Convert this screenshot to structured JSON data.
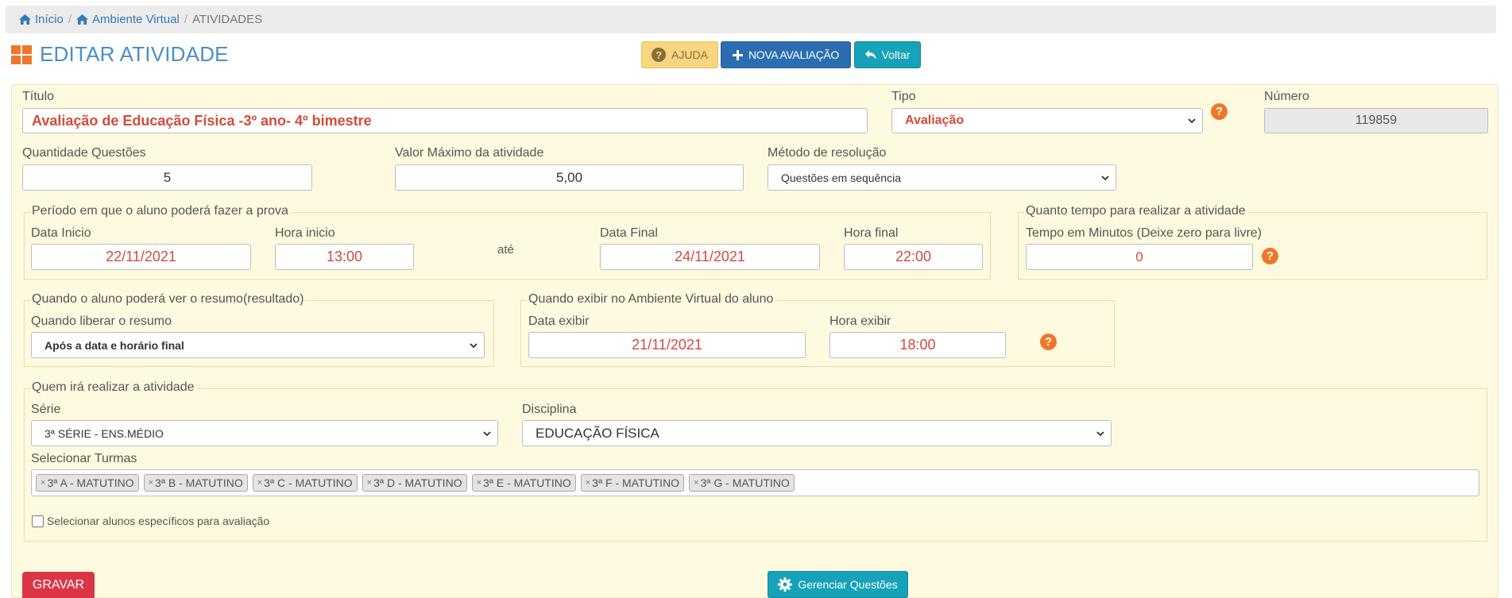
{
  "breadcrumb": {
    "items": [
      {
        "label": "Início"
      },
      {
        "label": "Ambiente Virtual"
      },
      {
        "label": "ATIVIDADES"
      }
    ]
  },
  "header": {
    "title": "EDITAR ATIVIDADE"
  },
  "toolbar": {
    "help_label": "AJUDA",
    "new_label": "NOVA AVALIAÇÃO",
    "back_label": "Voltar"
  },
  "form": {
    "titulo": {
      "label": "Título",
      "value": "Avaliação de Educação Física -3º ano- 4º bimestre"
    },
    "tipo": {
      "label": "Tipo",
      "value": "Avaliação"
    },
    "numero": {
      "label": "Número",
      "value": "119859"
    },
    "qtd_questoes": {
      "label": "Quantidade Questões",
      "value": "5"
    },
    "valor_maximo": {
      "label": "Valor Máximo da atividade",
      "value": "5,00"
    },
    "metodo": {
      "label": "Método de resolução",
      "value": "Questões em sequência"
    },
    "periodo": {
      "legend": "Período em que o aluno poderá fazer a prova",
      "data_inicio": {
        "label": "Data Inicio",
        "value": "22/11/2021"
      },
      "hora_inicio": {
        "label": "Hora inicio",
        "value": "13:00"
      },
      "ate": "até",
      "data_final": {
        "label": "Data Final",
        "value": "24/11/2021"
      },
      "hora_final": {
        "label": "Hora final",
        "value": "22:00"
      }
    },
    "tempo": {
      "legend": "Quanto tempo para realizar a atividade",
      "label": "Tempo em Minutos (Deixe zero para livre)",
      "value": "0"
    },
    "resumo": {
      "legend": "Quando o aluno poderá ver o resumo(resultado)",
      "label": "Quando liberar o resumo",
      "value": "Após a data e horário final"
    },
    "exibir": {
      "legend": "Quando exibir no Ambiente Virtual do aluno",
      "data": {
        "label": "Data exibir",
        "value": "21/11/2021"
      },
      "hora": {
        "label": "Hora exibir",
        "value": "18:00"
      }
    },
    "quem": {
      "legend": "Quem irá realizar a atividade",
      "serie": {
        "label": "Série",
        "value": "3ª SÉRIE - ENS.MÉDIO"
      },
      "disciplina": {
        "label": "Disciplina",
        "value": "EDUCAÇÃO FÍSICA"
      },
      "turmas_label": "Selecionar Turmas",
      "turmas": [
        "3ª A - MATUTINO",
        "3ª B - MATUTINO",
        "3ª C - MATUTINO",
        "3ª D - MATUTINO",
        "3ª E - MATUTINO",
        "3ª F - MATUTINO",
        "3ª G - MATUTINO"
      ],
      "checkbox_label": "Selecionar alunos específicos para avaliação"
    }
  },
  "actions": {
    "save_label": "GRAVAR",
    "manage_label": "Gerenciar Questões"
  },
  "colors": {
    "accent_orange": "#f0762a",
    "primary_blue": "#2a6db0",
    "info_teal": "#16a2b8",
    "danger_red": "#dc3545",
    "panel_bg": "#fefae0"
  }
}
